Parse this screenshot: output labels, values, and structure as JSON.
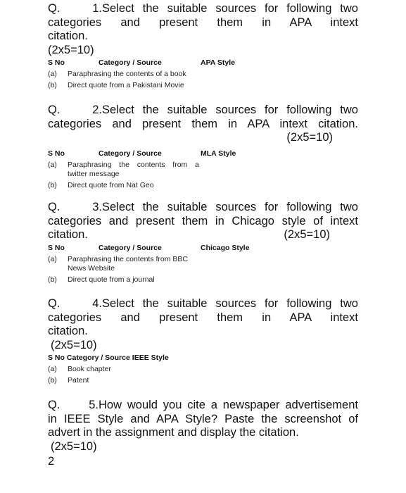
{
  "questions": [
    {
      "number": "Q. 1.",
      "lines": [
        "Select the suitable sources for following two",
        "categories and present them in APA intext",
        "citation."
      ],
      "marks": "(2x5=10)",
      "table": {
        "headers": [
          "S No",
          "Category / Source",
          "APA Style"
        ],
        "rows": [
          {
            "sn": "(a)",
            "category": "Paraphrasing the contents of a book"
          },
          {
            "sn": "(b)",
            "category": "Direct quote from a Pakistani Movie"
          }
        ]
      }
    },
    {
      "number": "Q. 2.",
      "lines": [
        "Select the suitable sources for following two",
        "categories and present them in APA intext citation."
      ],
      "marks": "(2x5=10)",
      "table": {
        "headers": [
          "S No",
          "Category / Source",
          "MLA Style"
        ],
        "rows": [
          {
            "sn": "(a)",
            "category_lines": [
              "Paraphrasing the contents from a",
              "twitter message"
            ]
          },
          {
            "sn": "(b)",
            "category": "Direct quote from Nat Geo"
          }
        ]
      }
    },
    {
      "number": "Q. 3.",
      "lines": [
        "Select the suitable sources for following two",
        "categories and present them in Chicago style of intext",
        "citation."
      ],
      "marks": "(2x5=10)",
      "table": {
        "headers": [
          "S No",
          "Category / Source",
          "Chicago Style"
        ],
        "rows": [
          {
            "sn": "(a)",
            "category_lines": [
              "Paraphrasing the contents from BBC",
              "News Website"
            ]
          },
          {
            "sn": "(b)",
            "category": "Direct quote from a journal"
          }
        ]
      }
    },
    {
      "number": "Q. 4.",
      "lines": [
        "Select the suitable sources for following two",
        "categories and present them in APA intext",
        "citation."
      ],
      "marks": "(2x5=10)",
      "table": {
        "headers": [
          "S No",
          "Category / Source",
          "IEEE Style"
        ],
        "rows": [
          {
            "sn": "(a)",
            "category": "Book chapter"
          },
          {
            "sn": "(b)",
            "category": "Patent"
          }
        ]
      }
    },
    {
      "number": "Q. 5.",
      "lines": [
        "How would you cite a newspaper advertisement",
        "in IEEE Style and APA Style? Paste the screenshot of",
        "advert in the assignment and display the citation."
      ],
      "marks": "(2x5=10)"
    }
  ],
  "page_number": "2"
}
